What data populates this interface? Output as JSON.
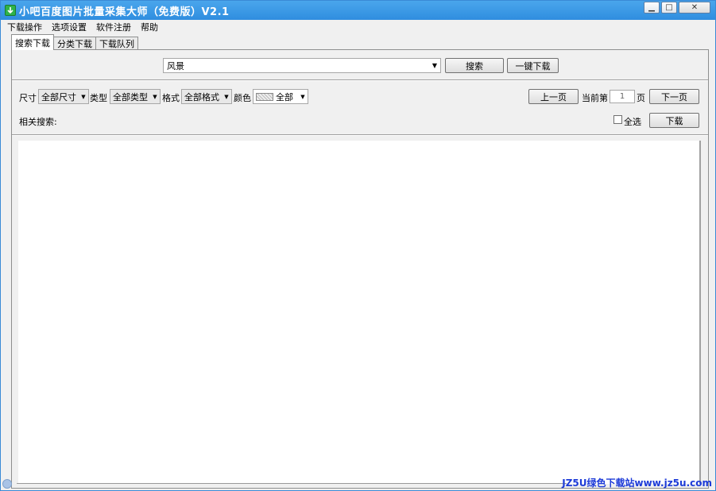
{
  "window": {
    "title": "小吧百度图片批量采集大师（免费版）V2.1",
    "controls": {
      "minimize": "▁",
      "maximize": "□",
      "close": "✕"
    }
  },
  "menu": [
    "下载操作",
    "选项设置",
    "软件注册",
    "帮助"
  ],
  "tabs": [
    {
      "label": "搜索下载",
      "active": true
    },
    {
      "label": "分类下载",
      "active": false
    },
    {
      "label": "下载队列",
      "active": false
    }
  ],
  "search": {
    "value": "风景",
    "search_button": "搜索",
    "one_click_button": "一键下载"
  },
  "filters": {
    "size_label": "尺寸",
    "size_value": "全部尺寸",
    "type_label": "类型",
    "type_value": "全部类型",
    "format_label": "格式",
    "format_value": "全部格式",
    "color_label": "颜色",
    "color_value": "全部"
  },
  "paging": {
    "prev_button": "上一页",
    "current_label": "当前第",
    "current_page": "1",
    "page_suffix": "页",
    "next_button": "下一页"
  },
  "related": {
    "label": "相关搜索:",
    "select_all_label": "全选",
    "download_button": "下载"
  },
  "watermark": "JZ5U绿色下载站www.jz5u.com",
  "colors": {
    "titlebar": "#2f8ddf",
    "watermark": "#1d3bd8"
  },
  "icons": {
    "app": "download-arrow-icon",
    "dropdown": "dropdown-arrow-icon"
  }
}
